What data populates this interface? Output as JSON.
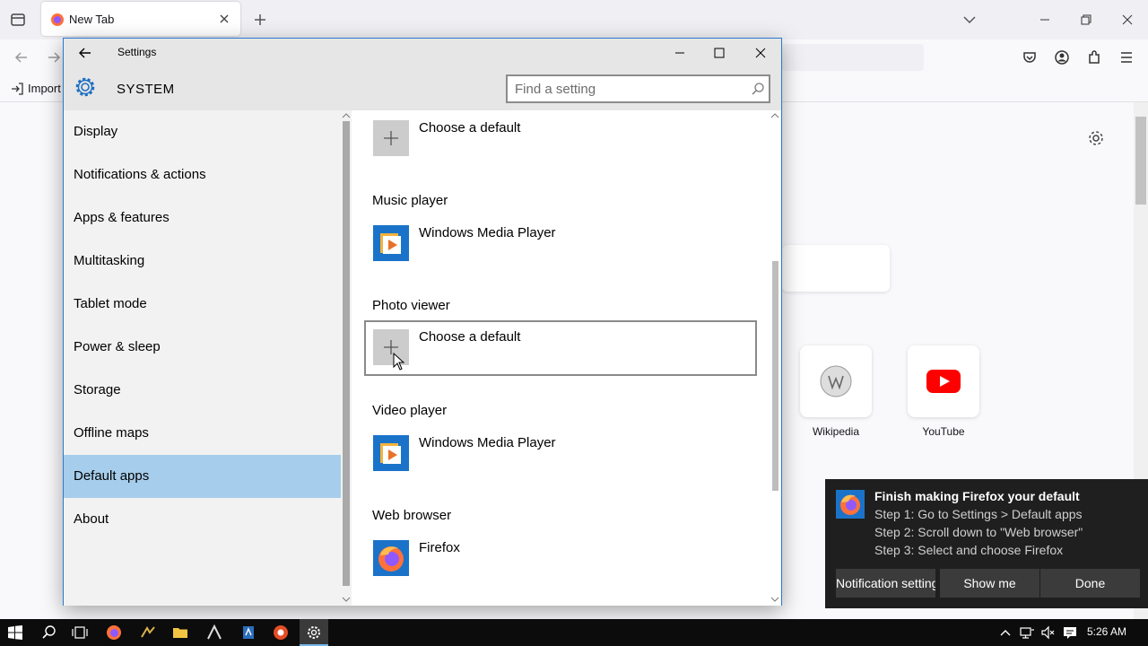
{
  "browser": {
    "tab_title": "New Tab",
    "import_label": "Import",
    "shortcuts": [
      {
        "label": "Wikipedia"
      },
      {
        "label": "YouTube"
      }
    ]
  },
  "settings": {
    "window_title": "Settings",
    "heading": "SYSTEM",
    "search_placeholder": "Find a setting",
    "nav": [
      {
        "label": "Display"
      },
      {
        "label": "Notifications & actions"
      },
      {
        "label": "Apps & features"
      },
      {
        "label": "Multitasking"
      },
      {
        "label": "Tablet mode"
      },
      {
        "label": "Power & sleep"
      },
      {
        "label": "Storage"
      },
      {
        "label": "Offline maps"
      },
      {
        "label": "Default apps"
      },
      {
        "label": "About"
      }
    ],
    "active_nav": "Default apps",
    "defaults": [
      {
        "category": "",
        "app": "Choose a default",
        "icon": "plus-icon"
      },
      {
        "category": "Music player",
        "app": "Windows Media Player",
        "icon": "media-player-icon"
      },
      {
        "category": "Photo viewer",
        "app": "Choose a default",
        "icon": "plus-icon"
      },
      {
        "category": "Video player",
        "app": "Windows Media Player",
        "icon": "media-player-icon"
      },
      {
        "category": "Web browser",
        "app": "Firefox",
        "icon": "firefox-icon"
      }
    ]
  },
  "toast": {
    "title": "Finish making Firefox your default",
    "lines": [
      "Step 1: Go to Settings > Default apps",
      "Step 2: Scroll down to \"Web browser\"",
      "Step 3: Select and choose Firefox"
    ],
    "buttons": [
      {
        "label": "Notification settings"
      },
      {
        "label": "Show me"
      },
      {
        "label": "Done"
      }
    ]
  },
  "taskbar": {
    "time": "5:26 AM"
  },
  "colors": {
    "accent": "#a6cdeb",
    "window_border": "#2b79d0",
    "toast_bg": "#1f1f1f"
  }
}
